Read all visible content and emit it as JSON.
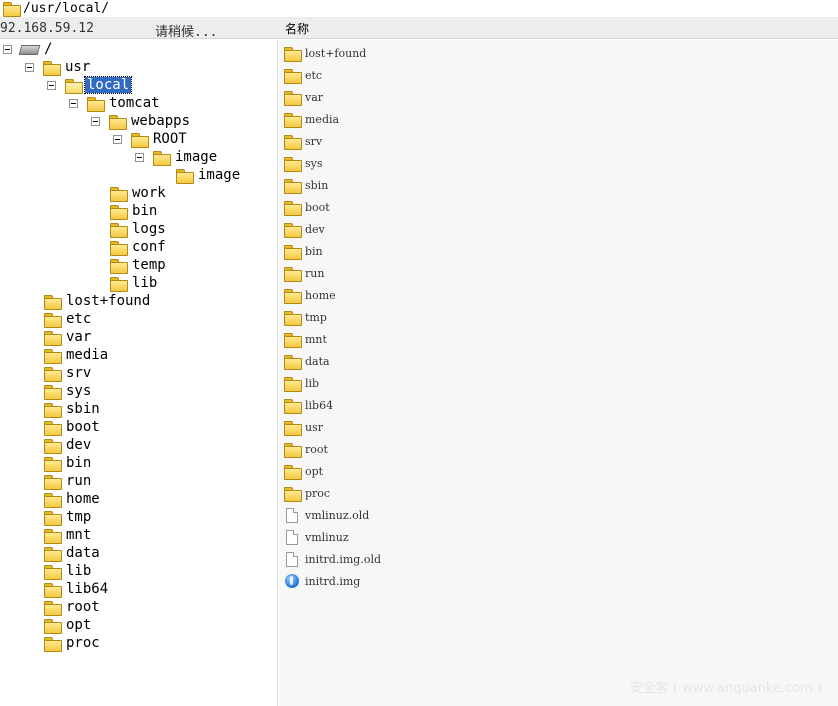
{
  "path_bar": {
    "path": "/usr/local/"
  },
  "status_bar": {
    "ip": "92.168.59.12",
    "loading": "请稍候...",
    "column_name": "名称"
  },
  "tree": {
    "root": "/",
    "usr": "usr",
    "local": "local",
    "tomcat": "tomcat",
    "webapps": "webapps",
    "root_dir": "ROOT",
    "image1": "image",
    "image2": "image",
    "tomcat_children": [
      "work",
      "bin",
      "logs",
      "conf",
      "temp",
      "lib"
    ],
    "root_children": [
      "lost+found",
      "etc",
      "var",
      "media",
      "srv",
      "sys",
      "sbin",
      "boot",
      "dev",
      "bin",
      "run",
      "home",
      "tmp",
      "mnt",
      "data",
      "lib",
      "lib64",
      "root",
      "opt",
      "proc"
    ],
    "selected": "local"
  },
  "file_list": {
    "folders": [
      "lost+found",
      "etc",
      "var",
      "media",
      "srv",
      "sys",
      "sbin",
      "boot",
      "dev",
      "bin",
      "run",
      "home",
      "tmp",
      "mnt",
      "data",
      "lib",
      "lib64",
      "usr",
      "root",
      "opt",
      "proc"
    ],
    "files": [
      {
        "name": "vmlinuz.old",
        "icon": "file-icon"
      },
      {
        "name": "vmlinuz",
        "icon": "file-icon"
      },
      {
        "name": "initrd.img.old",
        "icon": "file-icon"
      },
      {
        "name": "initrd.img",
        "icon": "ie-link-icon"
      }
    ]
  },
  "watermark": "安全客 ( www.anquanke.com )"
}
